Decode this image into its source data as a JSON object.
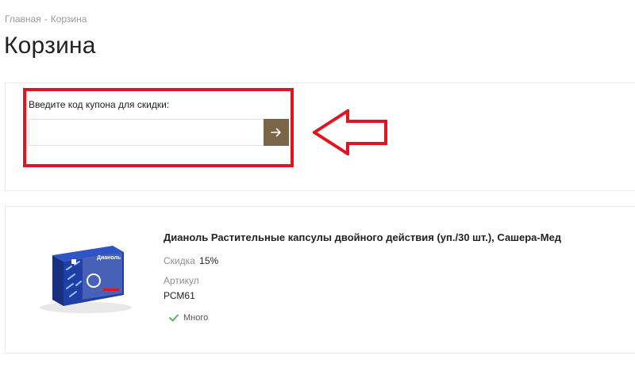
{
  "breadcrumb": {
    "home": "Главная",
    "separator": "-",
    "current": "Корзина"
  },
  "page": {
    "title": "Корзина"
  },
  "coupon": {
    "label": "Введите код купона для скидки:",
    "value": "",
    "placeholder": "",
    "submit_icon": "arrow-right-icon"
  },
  "annotation": {
    "highlight_color": "#e2141f",
    "arrow_color": "#e2141f",
    "arrow_direction": "left"
  },
  "product": {
    "title": "Дианоль Растительные капсулы двойного действия (уп./30 шт.), Сашера-Мед",
    "discount_label": "Скидка",
    "discount_value": "15%",
    "article_label": "Артикул",
    "article_value": "РСМ61",
    "stock_text": "Много",
    "stock_icon": "checkmark-icon",
    "package_brand": "Дианоль"
  },
  "colors": {
    "accent": "#7b6548",
    "stock_check": "#4caf50",
    "package_blue": "#1f3fa6"
  }
}
